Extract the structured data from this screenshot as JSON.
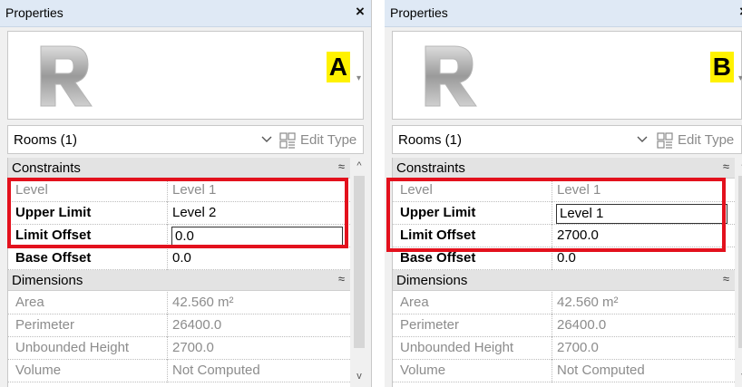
{
  "colors": {
    "highlight_box": "#e3111d",
    "badge_yellow": "#fff200",
    "titlebar": "#dfe9f5"
  },
  "panels": [
    {
      "title": "Properties",
      "close_icon": "×",
      "badge": "A",
      "type_selector": "Rooms (1)",
      "edit_type": "Edit Type",
      "constraints": {
        "label": "Constraints",
        "rows": [
          {
            "name": "Level",
            "value": "Level 1"
          },
          {
            "name": "Upper Limit",
            "value": "Level 2"
          },
          {
            "name": "Limit Offset",
            "value": "0.0"
          },
          {
            "name": "Base Offset",
            "value": "0.0"
          }
        ]
      },
      "dimensions": {
        "label": "Dimensions",
        "rows": [
          {
            "name": "Area",
            "value": "42.560 m²"
          },
          {
            "name": "Perimeter",
            "value": "26400.0"
          },
          {
            "name": "Unbounded Height",
            "value": "2700.0"
          },
          {
            "name": "Volume",
            "value": "Not Computed"
          }
        ]
      }
    },
    {
      "title": "Properties",
      "close_icon": "×",
      "badge": "B",
      "type_selector": "Rooms (1)",
      "edit_type": "Edit Type",
      "constraints": {
        "label": "Constraints",
        "rows": [
          {
            "name": "Level",
            "value": "Level 1"
          },
          {
            "name": "Upper Limit",
            "value": "Level 1"
          },
          {
            "name": "Limit Offset",
            "value": "2700.0"
          },
          {
            "name": "Base Offset",
            "value": "0.0"
          }
        ]
      },
      "dimensions": {
        "label": "Dimensions",
        "rows": [
          {
            "name": "Area",
            "value": "42.560 m²"
          },
          {
            "name": "Perimeter",
            "value": "26400.0"
          },
          {
            "name": "Unbounded Height",
            "value": "2700.0"
          },
          {
            "name": "Volume",
            "value": "Not Computed"
          }
        ]
      }
    }
  ],
  "icons": {
    "logo": "revit-r-logo-icon",
    "collapse": "double-chevron-up-icon",
    "type_dropdown": "chevron-down-icon",
    "edit_type": "edit-type-icon",
    "close": "close-icon"
  }
}
